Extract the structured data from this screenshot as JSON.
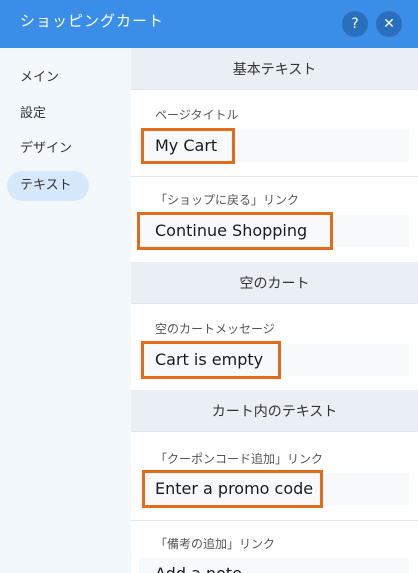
{
  "header": {
    "title": "ショッピングカート",
    "help_icon": "?",
    "close_icon": "✕"
  },
  "sidebar": {
    "items": [
      {
        "label": "メイン"
      },
      {
        "label": "設定"
      },
      {
        "label": "デザイン"
      },
      {
        "label": "テキスト",
        "active": true
      }
    ]
  },
  "sections": [
    {
      "title": "基本テキスト",
      "fields": [
        {
          "label": "ページタイトル",
          "value": "My Cart"
        },
        {
          "label": "「ショップに戻る」リンク",
          "value": "Continue Shopping"
        }
      ]
    },
    {
      "title": "空のカート",
      "fields": [
        {
          "label": "空のカートメッセージ",
          "value": "Cart is empty"
        }
      ]
    },
    {
      "title": "カート内のテキスト",
      "fields": [
        {
          "label": "「クーポンコード追加」リンク",
          "value": "Enter a promo code"
        },
        {
          "label": "「備考の追加」リンク",
          "value": "Add a note"
        }
      ]
    }
  ],
  "colors": {
    "header": "#3b8ee8",
    "highlight": "#e36b1a",
    "sidebar": "#f3f8fd"
  }
}
